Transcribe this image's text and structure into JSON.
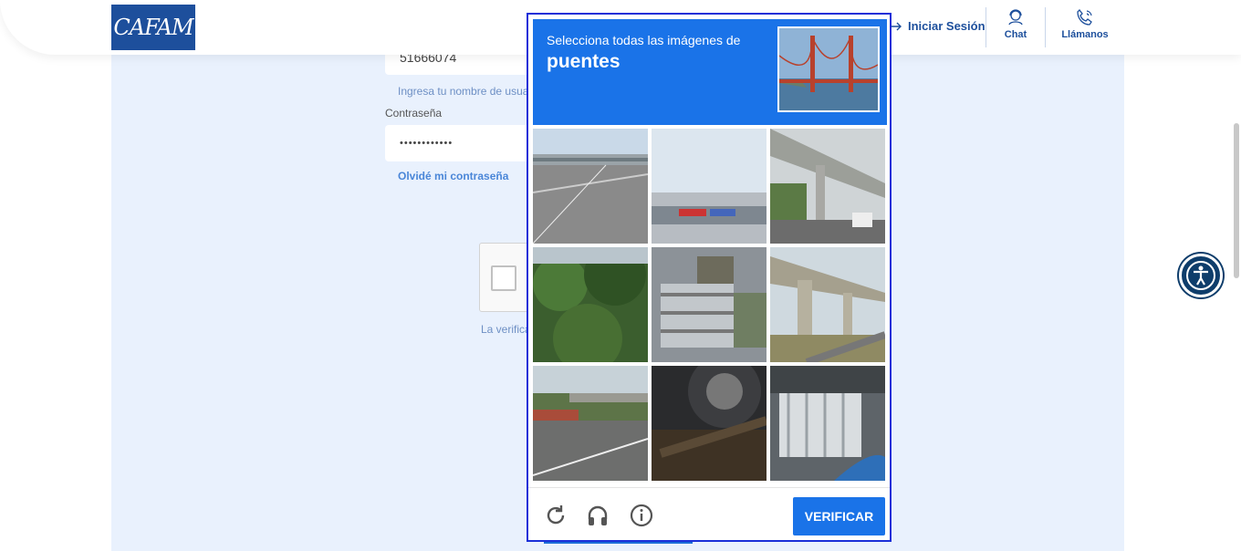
{
  "header": {
    "logo_text": "CAFAM",
    "login_label": "Iniciar Sesión",
    "chat_label": "Chat",
    "call_label": "Llámanos"
  },
  "form": {
    "document_value": "51666074",
    "document_hint": "Ingresa tu nombre de usua",
    "password_label": "Contraseña",
    "password_value": "••••••••••••",
    "forgot_label": "Olvidé mi contraseña",
    "verification_text": "La verifica"
  },
  "captcha": {
    "instruction": "Selecciona todas las imágenes de",
    "target": "puentes",
    "verify_label": "VERIFICAR",
    "tiles": [
      "highway-overpass",
      "building-facade",
      "elevated-road",
      "forest-trees",
      "stacked-panels",
      "bridge-underside",
      "road-overpass",
      "car-wheel",
      "white-chairs"
    ]
  },
  "colors": {
    "brand": "#1d4f9c",
    "captcha_blue": "#1a73e8",
    "panel_bg": "#e9f1fd"
  }
}
